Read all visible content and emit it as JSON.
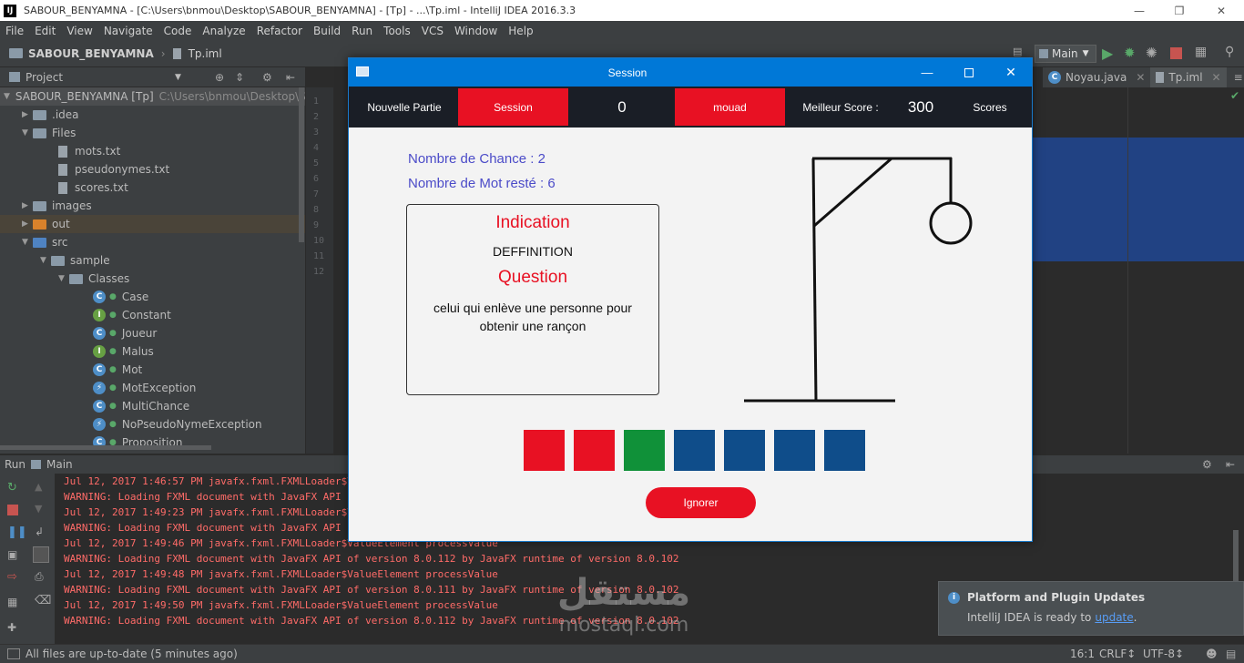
{
  "ide": {
    "window_title": "SABOUR_BENYAMNA - [C:\\Users\\bnmou\\Desktop\\SABOUR_BENYAMNA] - [Tp] - ...\\Tp.iml - IntelliJ IDEA 2016.3.3",
    "app_icon": "IJ",
    "menu": [
      "File",
      "Edit",
      "View",
      "Navigate",
      "Code",
      "Analyze",
      "Refactor",
      "Build",
      "Run",
      "Tools",
      "VCS",
      "Window",
      "Help"
    ],
    "breadcrumb": {
      "project": "SABOUR_BENYAMNA",
      "file": "Tp.iml"
    },
    "run_config": "Main",
    "project_panel_label": "Project",
    "tree": [
      {
        "label": "SABOUR_BENYAMNA [Tp]",
        "extra": "C:\\Users\\bnmou\\Desktop\\S"
      },
      {
        "label": ".idea"
      },
      {
        "label": "Files"
      },
      {
        "label": "mots.txt"
      },
      {
        "label": "pseudonymes.txt"
      },
      {
        "label": "scores.txt"
      },
      {
        "label": "images"
      },
      {
        "label": "out"
      },
      {
        "label": "src"
      },
      {
        "label": "sample"
      },
      {
        "label": "Classes"
      },
      {
        "label": "Case"
      },
      {
        "label": "Constant"
      },
      {
        "label": "Joueur"
      },
      {
        "label": "Malus"
      },
      {
        "label": "Mot"
      },
      {
        "label": "MotException"
      },
      {
        "label": "MultiChance"
      },
      {
        "label": "NoPseudoNymeException"
      },
      {
        "label": "Proposition"
      }
    ],
    "line_numbers": [
      "1",
      "2",
      "3",
      "4",
      "5",
      "6",
      "7",
      "8",
      "9",
      "10",
      "11",
      "12"
    ],
    "editor_tabs": [
      "Noyau.java",
      "Tp.iml"
    ],
    "run_panel": {
      "label": "Run",
      "config": "Main"
    },
    "console_lines": [
      "Jul 12, 2017 1:46:57 PM javafx.fxml.FXMLLoader$ValueElement processValue",
      "WARNING: Loading FXML document with JavaFX API of version 8.0.112 by JavaFX runtime of version 8.0.102",
      "Jul 12, 2017 1:49:23 PM javafx.fxml.FXMLLoader$ValueElement processValue",
      "WARNING: Loading FXML document with JavaFX API of version 8.0.112 by JavaFX runtime of version 8.0.102",
      "Jul 12, 2017 1:49:46 PM javafx.fxml.FXMLLoader$ValueElement processValue",
      "WARNING: Loading FXML document with JavaFX API of version 8.0.112 by JavaFX runtime of version 8.0.102",
      "Jul 12, 2017 1:49:48 PM javafx.fxml.FXMLLoader$ValueElement processValue",
      "WARNING: Loading FXML document with JavaFX API of version 8.0.111 by JavaFX runtime of version 8.0.102",
      "Jul 12, 2017 1:49:50 PM javafx.fxml.FXMLLoader$ValueElement processValue",
      "WARNING: Loading FXML document with JavaFX API of version 8.0.112 by JavaFX runtime of version 8.0.102"
    ],
    "notification": {
      "title": "Platform and Plugin Updates",
      "text": "IntelliJ IDEA is ready to",
      "link": "update",
      "end": "."
    },
    "status": {
      "message": "All files are up-to-date (5 minutes ago)",
      "position": "16:1",
      "line_sep": "CRLF↕",
      "encoding": "UTF-8↕"
    },
    "watermark": {
      "arabic": "مستقل",
      "latin": "mostaql.com"
    }
  },
  "dialog": {
    "title": "Session",
    "topbar": {
      "nouvelle_partie": "Nouvelle Partie",
      "session_btn": "Session",
      "score": "0",
      "player_btn": "mouad",
      "best_label": "Meilleur Score  :",
      "best_value": "300",
      "scores": "Scores"
    },
    "chances": "Nombre de Chance : 2",
    "mots_restes": "Nombre de Mot resté : 6",
    "indication_title": "Indication",
    "indication_text": "DEFFINITION",
    "question_title": "Question",
    "question_text": "celui qui enlève une personne pour obtenir une rançon",
    "letter_boxes": [
      "#e81123",
      "#e81123",
      "#109139",
      "#0f4d8a",
      "#0f4d8a",
      "#0f4d8a",
      "#0f4d8a"
    ],
    "ignore_btn": "Ignorer"
  },
  "colors": {
    "ide_bg": "#2b2b2b",
    "panel_bg": "#3c3f41",
    "console_red": "#ff6b68",
    "dialog_title_blue": "#0078d7",
    "accent_red": "#e81123",
    "info_purple": "#4b4bc8",
    "editor_selection": "#214283"
  }
}
